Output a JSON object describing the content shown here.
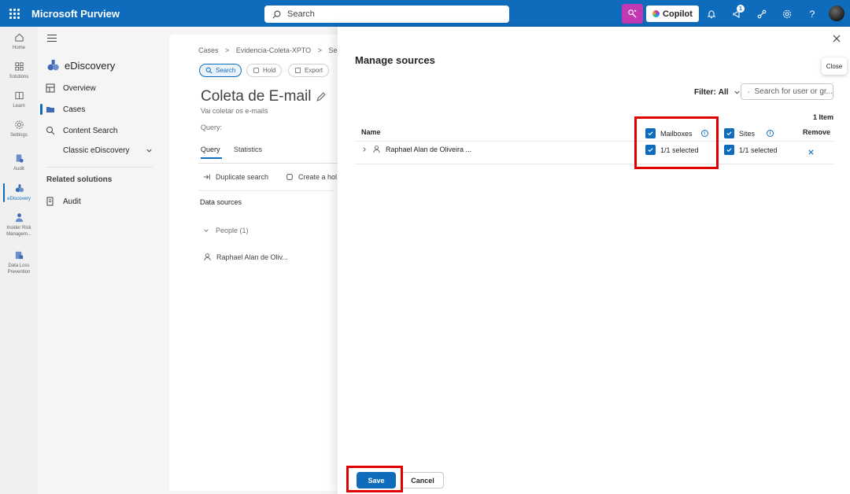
{
  "app": {
    "title": "Microsoft Purview"
  },
  "topbar": {
    "search_placeholder": "Search",
    "copilot_label": "Copilot",
    "notification_badge": "1"
  },
  "rail": {
    "items": [
      {
        "label": "Home",
        "icon": "home-icon"
      },
      {
        "label": "Solutions",
        "icon": "solutions-icon"
      },
      {
        "label": "Learn",
        "icon": "learn-icon"
      },
      {
        "label": "Settings",
        "icon": "gear-icon"
      },
      {
        "label": "Audit",
        "icon": "audit-icon"
      },
      {
        "label": "eDiscovery",
        "icon": "ediscovery-icon"
      },
      {
        "label": "Insider Risk Managem...",
        "icon": "insider-risk-icon"
      },
      {
        "label": "Data Loss Prevention",
        "icon": "data-loss-icon"
      }
    ]
  },
  "nav": {
    "title": "eDiscovery",
    "items": [
      {
        "label": "Overview"
      },
      {
        "label": "Cases"
      },
      {
        "label": "Content Search"
      },
      {
        "label": "Classic eDiscovery"
      }
    ],
    "related_title": "Related solutions",
    "related_items": [
      {
        "label": "Audit"
      }
    ]
  },
  "case": {
    "breadcrumb": [
      "Cases",
      "Evidencia-Coleta-XPTO",
      "Searc"
    ],
    "pills": [
      "Search",
      "Hold",
      "Export"
    ],
    "title": "Coleta de E-mail",
    "subtitle": "Vai coletar os e-mails",
    "query_label": "Query:",
    "tabs": [
      "Query",
      "Statistics"
    ],
    "actions": [
      "Duplicate search",
      "Create a hol"
    ],
    "data_sources_heading": "Data sources",
    "people_group": "People (1)",
    "person": "Raphael Alan de Oliv..."
  },
  "panel": {
    "title": "Manage sources",
    "close_tooltip": "Close",
    "filter_label": "Filter:",
    "filter_value": "All",
    "search_placeholder": "Search for user or gr...",
    "item_count": "1 Item",
    "columns": {
      "name": "Name",
      "mailboxes": "Mailboxes",
      "sites": "Sites",
      "remove": "Remove"
    },
    "rows": [
      {
        "name": "Raphael Alan de Oliveira ...",
        "mailboxes": "1/1 selected",
        "sites": "1/1 selected"
      }
    ],
    "save_label": "Save",
    "cancel_label": "Cancel"
  },
  "colors": {
    "accent": "#0f6cbd",
    "highlight": "#e00000",
    "copilot": "#c239b3"
  }
}
